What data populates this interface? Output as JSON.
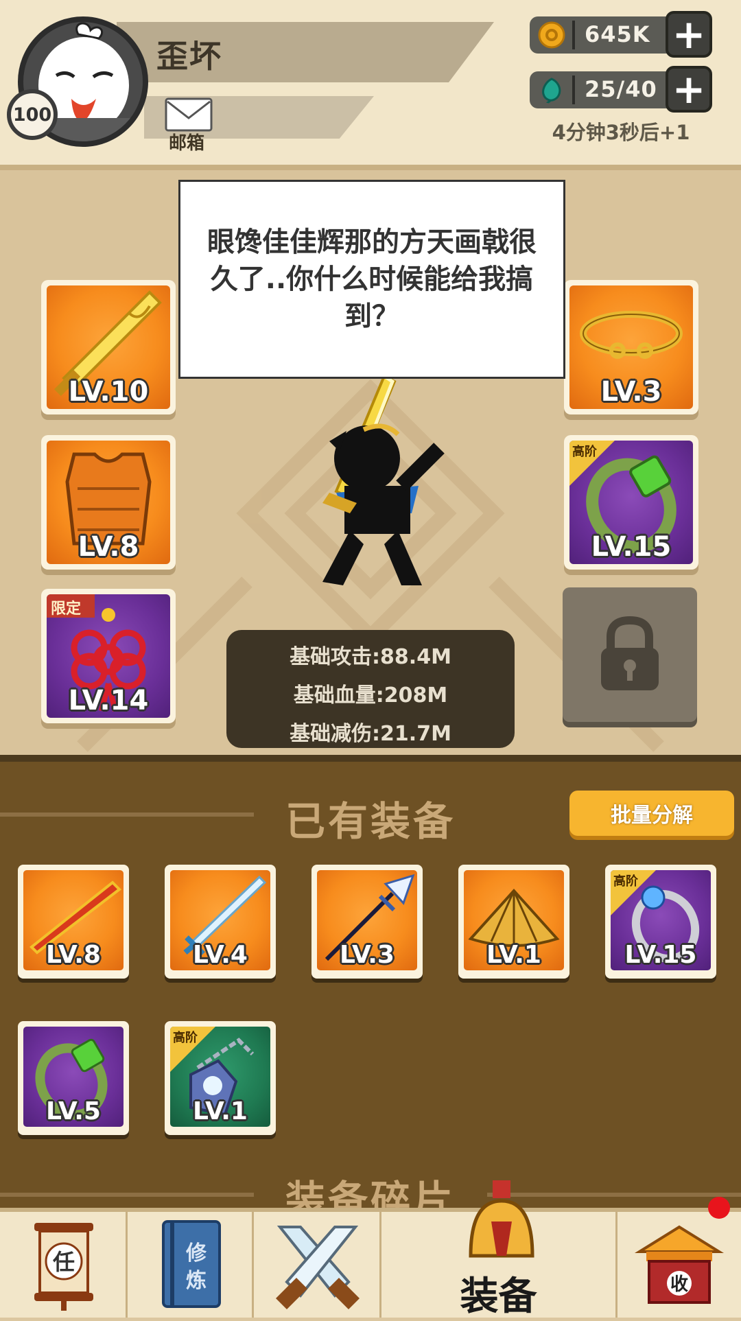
{
  "player": {
    "name": "歪坏",
    "level": "100",
    "mailbox_label": "邮箱"
  },
  "resources": {
    "gold": "645K",
    "energy": "25/40",
    "energy_timer": "4分钟3秒后+1",
    "plus_symbol": "+"
  },
  "dialog": {
    "text": "眼馋佳佳辉那的方天画戟很久了..你什么时候能给我搞到？"
  },
  "equipped": [
    {
      "slot": "weapon",
      "level": "LV.10",
      "rarity": "orange"
    },
    {
      "slot": "armor",
      "level": "LV.8",
      "rarity": "orange"
    },
    {
      "slot": "accessory",
      "level": "LV.14",
      "rarity": "purple",
      "tag": "限定"
    },
    {
      "slot": "headband",
      "level": "LV.3",
      "rarity": "orange"
    },
    {
      "slot": "ring",
      "level": "LV.15",
      "rarity": "purple",
      "tag": "高阶"
    }
  ],
  "stats": {
    "attack": "基础攻击:88.4M",
    "hp": "基础血量:208M",
    "reduction": "基础减伤:21.7M"
  },
  "inventory": {
    "title": "已有装备",
    "bulk_button": "批量分解",
    "items": [
      {
        "name": "staff",
        "level": "LV.8",
        "rarity": "orange"
      },
      {
        "name": "sword",
        "level": "LV.4",
        "rarity": "orange"
      },
      {
        "name": "halberd",
        "level": "LV.3",
        "rarity": "orange"
      },
      {
        "name": "hat",
        "level": "LV.1",
        "rarity": "orange"
      },
      {
        "name": "orb-ring",
        "level": "LV.15",
        "rarity": "purple",
        "tag": "高阶"
      },
      {
        "name": "jade-ring",
        "level": "LV.5",
        "rarity": "purple"
      },
      {
        "name": "amulet",
        "level": "LV.1",
        "rarity": "green",
        "tag": "高阶"
      }
    ],
    "shards_title": "装备碎片"
  },
  "nav": {
    "task_glyph": "任",
    "train_glyph": "修炼",
    "equip_label": "装备",
    "collect_glyph": "收"
  },
  "colors": {
    "gold": "#f0a81c",
    "energy": "#1fa58f",
    "accent_orange": "#f78c1d",
    "purple": "#6a2f98",
    "alert": "#e8141c"
  }
}
